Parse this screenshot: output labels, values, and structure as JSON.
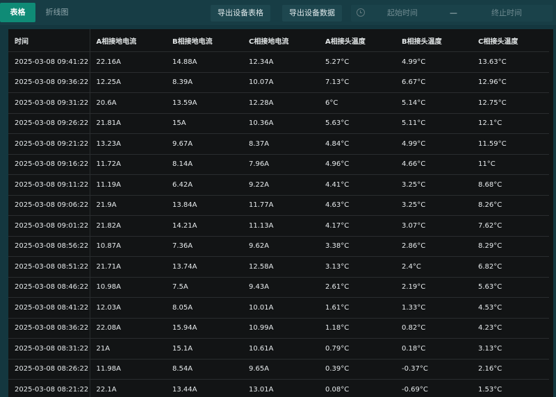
{
  "tabs": [
    {
      "label": "表格",
      "active": true
    },
    {
      "label": "折线图",
      "active": false
    }
  ],
  "toolbar": {
    "export_table_label": "导出设备表格",
    "export_data_label": "导出设备数据"
  },
  "date_range": {
    "start_placeholder": "起始时间",
    "separator": "—",
    "end_placeholder": "终止时间"
  },
  "table": {
    "columns": [
      "时间",
      "A相接地电流",
      "B相接地电流",
      "C相接地电流",
      "A相接头温度",
      "B相接头温度",
      "C相接头温度"
    ],
    "rows": [
      [
        "2025-03-08 09:41:22",
        "22.16A",
        "14.88A",
        "12.34A",
        "5.27°C",
        "4.99°C",
        "13.63°C"
      ],
      [
        "2025-03-08 09:36:22",
        "12.25A",
        "8.39A",
        "10.07A",
        "7.13°C",
        "6.67°C",
        "12.96°C"
      ],
      [
        "2025-03-08 09:31:22",
        "20.6A",
        "13.59A",
        "12.28A",
        "6°C",
        "5.14°C",
        "12.75°C"
      ],
      [
        "2025-03-08 09:26:22",
        "21.81A",
        "15A",
        "10.36A",
        "5.63°C",
        "5.11°C",
        "12.1°C"
      ],
      [
        "2025-03-08 09:21:22",
        "13.23A",
        "9.67A",
        "8.37A",
        "4.84°C",
        "4.99°C",
        "11.59°C"
      ],
      [
        "2025-03-08 09:16:22",
        "11.72A",
        "8.14A",
        "7.96A",
        "4.96°C",
        "4.66°C",
        "11°C"
      ],
      [
        "2025-03-08 09:11:22",
        "11.19A",
        "6.42A",
        "9.22A",
        "4.41°C",
        "3.25°C",
        "8.68°C"
      ],
      [
        "2025-03-08 09:06:22",
        "21.9A",
        "13.84A",
        "11.77A",
        "4.63°C",
        "3.25°C",
        "8.26°C"
      ],
      [
        "2025-03-08 09:01:22",
        "21.82A",
        "14.21A",
        "11.13A",
        "4.17°C",
        "3.07°C",
        "7.62°C"
      ],
      [
        "2025-03-08 08:56:22",
        "10.87A",
        "7.36A",
        "9.62A",
        "3.38°C",
        "2.86°C",
        "8.29°C"
      ],
      [
        "2025-03-08 08:51:22",
        "21.71A",
        "13.74A",
        "12.58A",
        "3.13°C",
        "2.4°C",
        "6.82°C"
      ],
      [
        "2025-03-08 08:46:22",
        "10.98A",
        "7.5A",
        "9.43A",
        "2.61°C",
        "2.19°C",
        "5.63°C"
      ],
      [
        "2025-03-08 08:41:22",
        "12.03A",
        "8.05A",
        "10.01A",
        "1.61°C",
        "1.33°C",
        "4.53°C"
      ],
      [
        "2025-03-08 08:36:22",
        "22.08A",
        "15.94A",
        "10.99A",
        "1.18°C",
        "0.82°C",
        "4.23°C"
      ],
      [
        "2025-03-08 08:31:22",
        "21A",
        "15.1A",
        "10.61A",
        "0.79°C",
        "0.18°C",
        "3.13°C"
      ],
      [
        "2025-03-08 08:26:22",
        "11.98A",
        "8.54A",
        "9.65A",
        "0.39°C",
        "-0.37°C",
        "2.16°C"
      ],
      [
        "2025-03-08 08:21:22",
        "22.1A",
        "13.44A",
        "13.01A",
        "0.08°C",
        "-0.69°C",
        "1.53°C"
      ]
    ]
  }
}
